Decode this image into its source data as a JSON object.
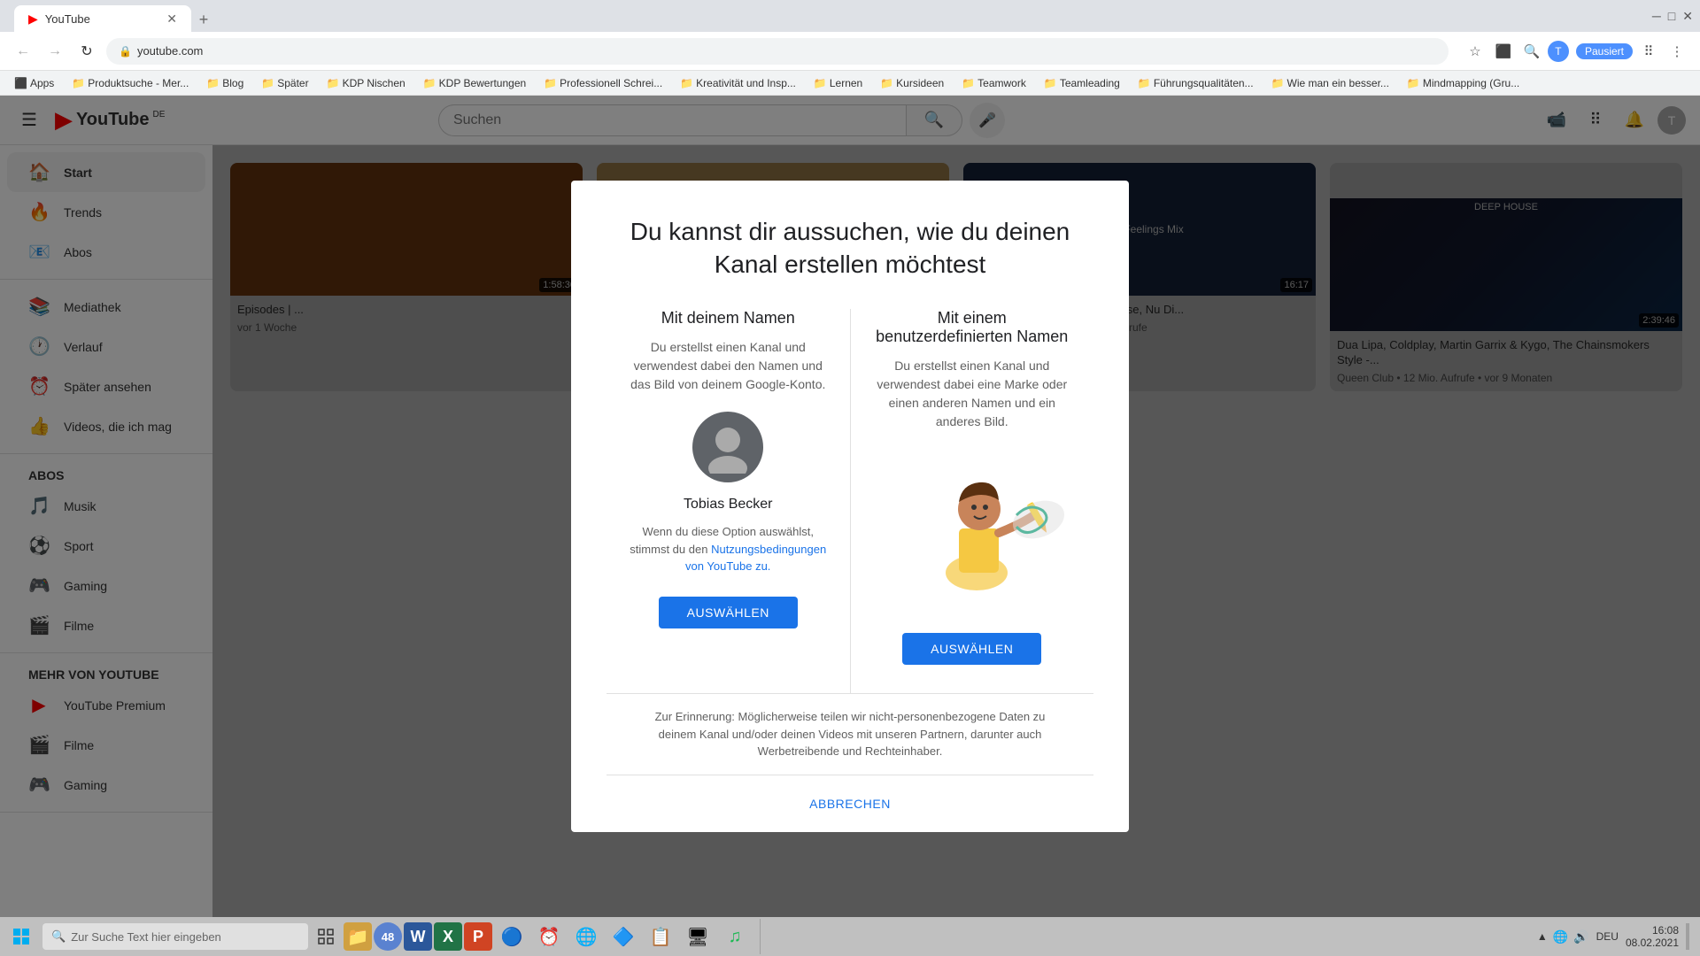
{
  "browser": {
    "tab": {
      "favicon": "▶",
      "title": "YouTube",
      "active": true
    },
    "new_tab_label": "+",
    "address": "youtube.com",
    "paused_label": "Pausiert",
    "bookmarks": [
      {
        "label": "Apps"
      },
      {
        "label": "Produktsuche - Mer..."
      },
      {
        "label": "Blog"
      },
      {
        "label": "Später"
      },
      {
        "label": "KDP Nischen"
      },
      {
        "label": "KDP Bewertungen"
      },
      {
        "label": "Professionell Schrei..."
      },
      {
        "label": "Kreativität und Insp..."
      },
      {
        "label": "Lernen"
      },
      {
        "label": "Kursideen"
      },
      {
        "label": "Teamwork"
      },
      {
        "label": "Teamleading"
      },
      {
        "label": "Führungsqualitäten..."
      },
      {
        "label": "Wie man ein besser..."
      },
      {
        "label": "Mindmapping (Gru..."
      }
    ]
  },
  "youtube": {
    "logo_text": "YouTube",
    "logo_sup": "DE",
    "search_placeholder": "Suchen",
    "header_icons": [
      "📹",
      "⠿",
      "🔔"
    ],
    "sidebar": {
      "sections": [
        {
          "items": [
            {
              "icon": "🏠",
              "label": "Start",
              "active": true
            },
            {
              "icon": "🔥",
              "label": "Trends"
            },
            {
              "icon": "📧",
              "label": "Abos"
            }
          ]
        },
        {
          "items": [
            {
              "icon": "📚",
              "label": "Mediathek"
            },
            {
              "icon": "🕐",
              "label": "Verlauf"
            },
            {
              "icon": "⏰",
              "label": "Später ansehen"
            },
            {
              "icon": "👍",
              "label": "Videos, die ich mag"
            }
          ]
        },
        {
          "title": "ABOS",
          "items": [
            {
              "icon": "🎵",
              "label": "Musik"
            },
            {
              "icon": "⚽",
              "label": "Sport"
            },
            {
              "icon": "🎮",
              "label": "Gaming"
            },
            {
              "icon": "🎬",
              "label": "Filme"
            }
          ]
        },
        {
          "title": "MEHR VON YOUTUBE",
          "items": [
            {
              "icon": "▶",
              "label": "YouTube Premium"
            },
            {
              "icon": "🎬",
              "label": "Filme"
            },
            {
              "icon": "🎮",
              "label": "Gaming"
            }
          ]
        }
      ]
    }
  },
  "modal": {
    "title": "Du kannst dir aussuchen, wie du deinen Kanal erstellen möchtest",
    "option1": {
      "title": "Mit deinem Namen",
      "desc": "Du erstellst einen Kanal und verwendest dabei den Namen und das Bild von deinem Google-Konto.",
      "user_name": "Tobias Becker",
      "tos_text": "Wenn du diese Option auswählst, stimmst du den",
      "tos_link": "Nutzungsbedingungen von YouTube zu.",
      "button": "AUSWÄHLEN"
    },
    "option2": {
      "title": "Mit einem benutzerdefinierten Namen",
      "desc": "Du erstellst einen Kanal und verwendest dabei eine Marke oder einen anderen Namen und ein anderes Bild.",
      "button": "AUSWÄHLEN"
    },
    "footer_info": "Zur Erinnerung: Möglicherweise teilen wir nicht-personenbezogene Daten zu deinem Kanal und/oder deinen Videos mit unseren Partnern, darunter auch Werbetreibende und Rechteinhaber.",
    "cancel_label": "ABBRECHEN"
  },
  "taskbar": {
    "search_placeholder": "Zur Suche Text hier eingeben",
    "time": "16:08",
    "date": "08.02.2021",
    "language": "DEU"
  }
}
